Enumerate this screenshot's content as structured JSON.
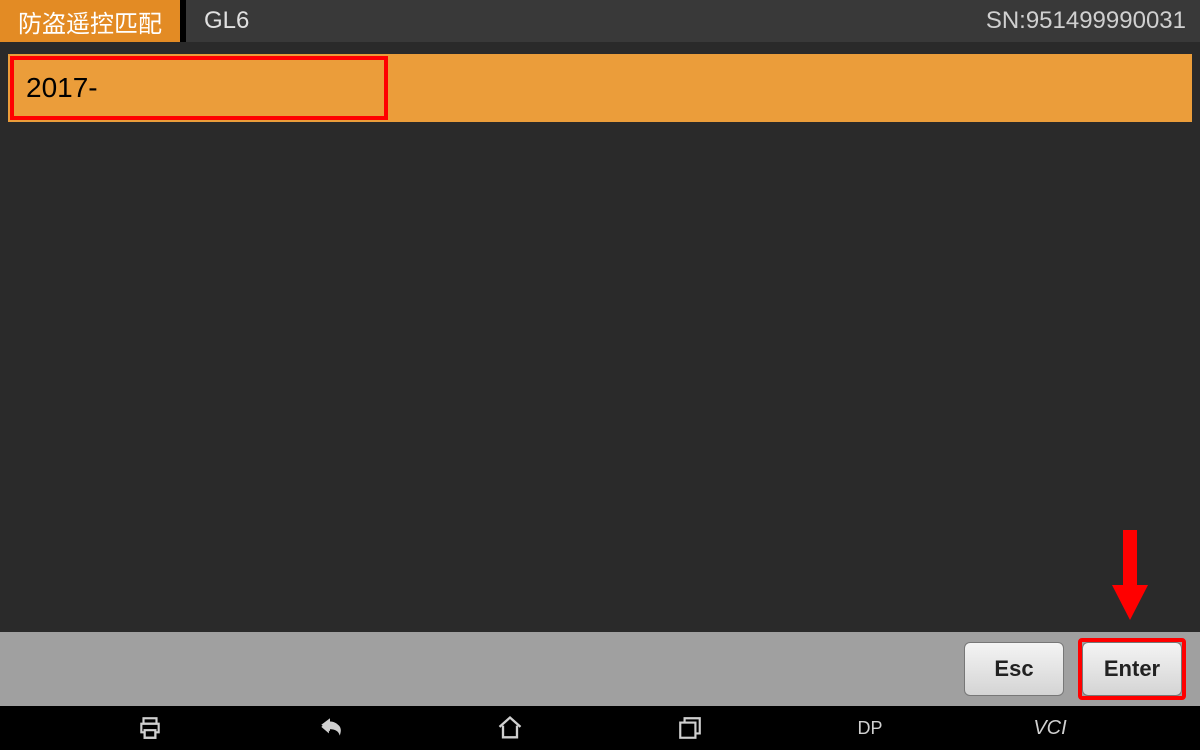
{
  "header": {
    "badge": "防盗遥控匹配",
    "title": "GL6",
    "sn": "SN:951499990031"
  },
  "list": {
    "items": [
      {
        "label": "2017-"
      }
    ]
  },
  "buttons": {
    "esc_label": "Esc",
    "enter_label": "Enter"
  },
  "navbar": {
    "dp_label": "DP",
    "vci_label": "VCI"
  }
}
